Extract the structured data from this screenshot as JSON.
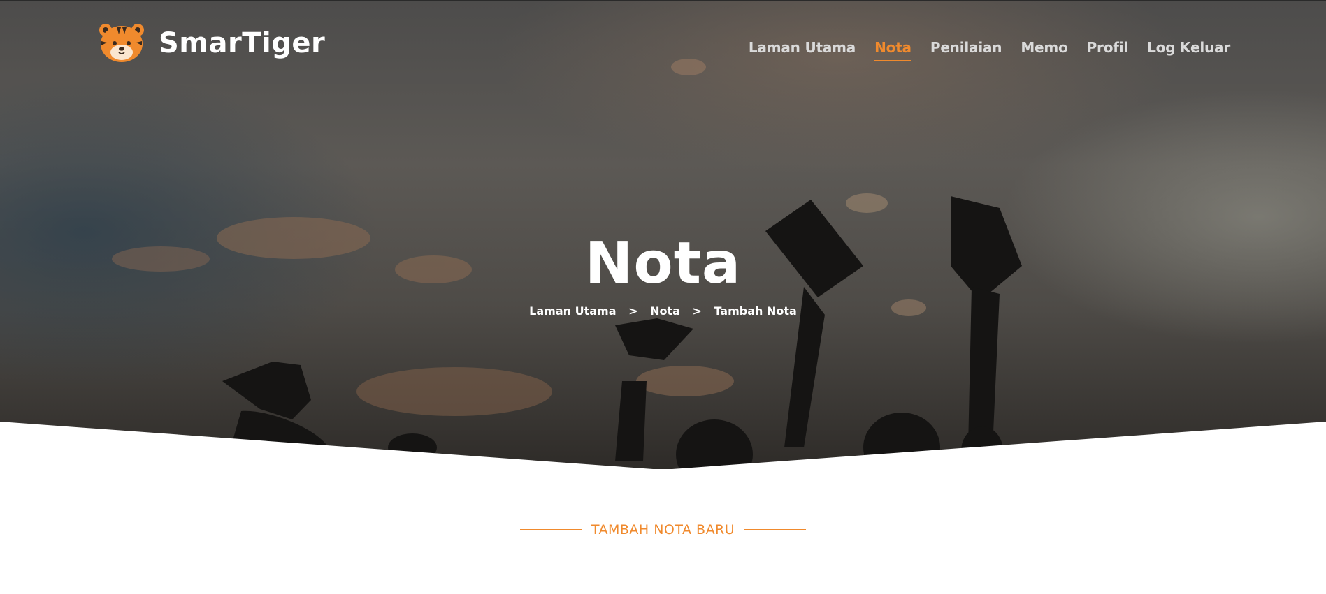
{
  "brand": {
    "name": "SmarTiger",
    "accent_color": "#f08a2d"
  },
  "nav": {
    "items": [
      {
        "label": "Laman Utama",
        "active": false
      },
      {
        "label": "Nota",
        "active": true
      },
      {
        "label": "Penilaian",
        "active": false
      },
      {
        "label": "Memo",
        "active": false
      },
      {
        "label": "Profil",
        "active": false
      },
      {
        "label": "Log Keluar",
        "active": false
      }
    ]
  },
  "hero": {
    "title": "Nota",
    "background_image": "graduation caps tossed against an evening sky",
    "breadcrumb": [
      "Laman Utama",
      "Nota",
      "Tambah Nota"
    ],
    "breadcrumb_separator": ">"
  },
  "section": {
    "title": "TAMBAH NOTA BARU"
  }
}
